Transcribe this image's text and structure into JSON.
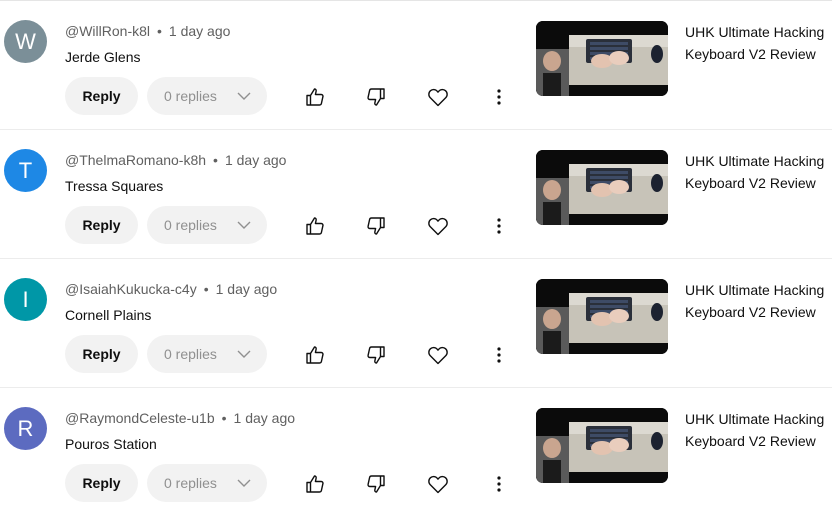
{
  "comments": [
    {
      "initial": "W",
      "avatar_color": "#7b8f98",
      "handle": "@WillRon-k8l",
      "time": "1 day ago",
      "text": "Jerde Glens",
      "reply_label": "Reply",
      "replies_label": "0 replies",
      "video_title": "UHK Ultimate Hacking Keyboard V2 Review"
    },
    {
      "initial": "T",
      "avatar_color": "#1e88e5",
      "handle": "@ThelmaRomano-k8h",
      "time": "1 day ago",
      "text": "Tressa Squares",
      "reply_label": "Reply",
      "replies_label": "0 replies",
      "video_title": "UHK Ultimate Hacking Keyboard V2 Review"
    },
    {
      "initial": "I",
      "avatar_color": "#0097a7",
      "handle": "@IsaiahKukucka-c4y",
      "time": "1 day ago",
      "text": "Cornell Plains",
      "reply_label": "Reply",
      "replies_label": "0 replies",
      "video_title": "UHK Ultimate Hacking Keyboard V2 Review"
    },
    {
      "initial": "R",
      "avatar_color": "#5c6bc0",
      "handle": "@RaymondCeleste-u1b",
      "time": "1 day ago",
      "text": "Pouros Station",
      "reply_label": "Reply",
      "replies_label": "0 replies",
      "video_title": "UHK Ultimate Hacking Keyboard V2 Review"
    }
  ],
  "icons": {
    "like": "thumbs-up-icon",
    "dislike": "thumbs-down-icon",
    "heart": "heart-icon",
    "more": "more-vertical-icon",
    "chevron": "chevron-down-icon"
  }
}
